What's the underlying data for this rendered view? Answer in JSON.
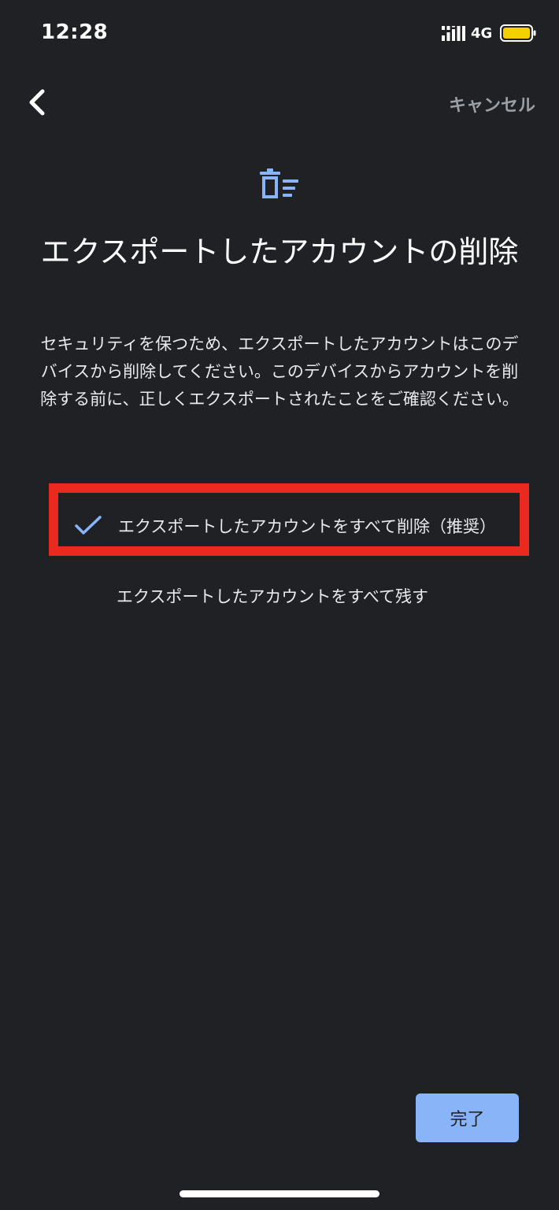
{
  "status_bar": {
    "time": "12:28",
    "network": "4G",
    "battery_color": "#f5d000"
  },
  "header": {
    "cancel_label": "キャンセル",
    "icon": "trash-list-icon",
    "title": "エクスポートしたアカウントの削除"
  },
  "description": "セキュリティを保つため、エクスポートしたアカウントはこのデバイスから削除してください。このデバイスからアカウントを削除する前に、正しくエクスポートされたことをご確認ください。",
  "options": [
    {
      "label": "エクスポートしたアカウントをすべて削除（推奨）",
      "selected": true
    },
    {
      "label": "エクスポートしたアカウントをすべて残す",
      "selected": false
    }
  ],
  "footer": {
    "done_label": "完了"
  },
  "colors": {
    "background": "#202124",
    "accent": "#8ab4f8",
    "highlight_border": "#ea2a1f"
  }
}
